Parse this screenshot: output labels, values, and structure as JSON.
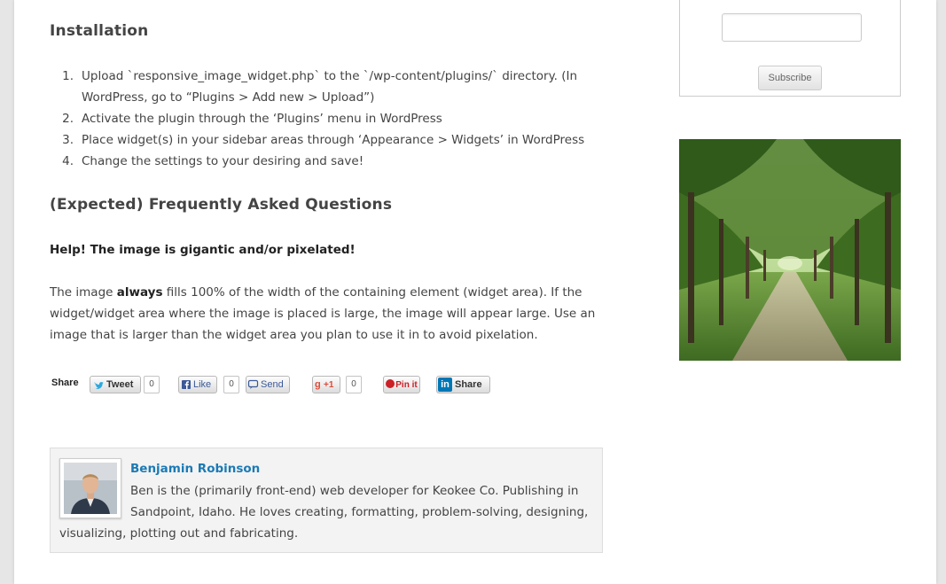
{
  "installation": {
    "heading": "Installation",
    "steps": [
      {
        "num": "1.",
        "line1": "Upload `responsive_image_widget.php` to the `/wp-content/plugins/` directory. (In",
        "line2": "WordPress, go to “Plugins > Add new > Upload”)"
      },
      {
        "num": "2.",
        "line1": "Activate the plugin through the ‘Plugins’ menu in WordPress"
      },
      {
        "num": "3.",
        "line1": "Place widget(s) in your sidebar areas through ‘Appearance > Widgets’ in WordPress"
      },
      {
        "num": "4.",
        "line1": "Change the settings to your desiring and save!"
      }
    ]
  },
  "faq": {
    "heading": "(Expected) Frequently Asked Questions",
    "question": "Help! The image is gigantic and/or pixelated!",
    "answer_pre": "The image ",
    "answer_bold": "always",
    "answer_line1_post": " fills 100% of the width of the containing element (widget area). If the",
    "answer_line2": "widget/widget area where the image is placed is large, the image will appear large. Use an",
    "answer_line3": "image that is larger than the widget area you plan to use it in to avoid pixelation."
  },
  "share": {
    "label": "Share",
    "tweet_label": "Tweet",
    "tweet_count": "0",
    "like_label": "Like",
    "like_count": "0",
    "send_label": "Send",
    "gplus_label": "+1",
    "gplus_count": "0",
    "pinit_label": "Pin it",
    "linkedin_label": "Share"
  },
  "author": {
    "name": "Benjamin Robinson",
    "bio_line1": "Ben is the (primarily front-end) web developer for Keokee Co. Publishing in",
    "bio_line2": "Sandpoint, Idaho. He loves creating, formatting, problem-solving, designing,",
    "bio_line3": "visualizing, plotting out and fabricating."
  },
  "sidebar": {
    "email_value": "",
    "subscribe_label": "Subscribe"
  },
  "colors": {
    "link": "#1b7ab5",
    "twitter": "#2aa9e0",
    "facebook": "#3b5998",
    "gplus": "#dd4b39",
    "pinterest": "#cb2027",
    "linkedin": "#0077b5"
  }
}
